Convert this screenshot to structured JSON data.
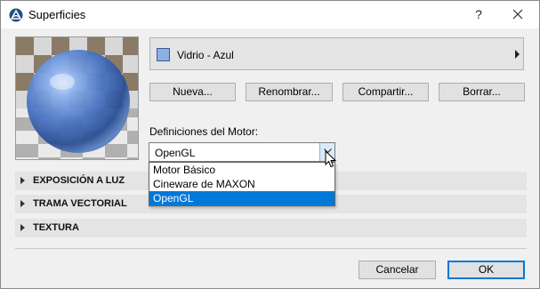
{
  "window": {
    "title": "Superficies"
  },
  "titlebar": {
    "help_label": "?"
  },
  "surface": {
    "name": "Vidrio - Azul",
    "swatch_color": "#8cb0e6"
  },
  "actions": {
    "new_label": "Nueva...",
    "rename_label": "Renombrar...",
    "share_label": "Compartir...",
    "delete_label": "Borrar..."
  },
  "engine": {
    "label": "Definiciones del Motor:",
    "selected": "OpenGL",
    "options": [
      "Motor Básico",
      "Cineware de MAXON",
      "OpenGL"
    ]
  },
  "sections": [
    "EXPOSICIÓN A LUZ",
    "TRAMA VECTORIAL",
    "TEXTURA"
  ],
  "footer": {
    "cancel_label": "Cancelar",
    "ok_label": "OK"
  },
  "colors": {
    "accent": "#0078d7",
    "selection": "#0078d7"
  }
}
